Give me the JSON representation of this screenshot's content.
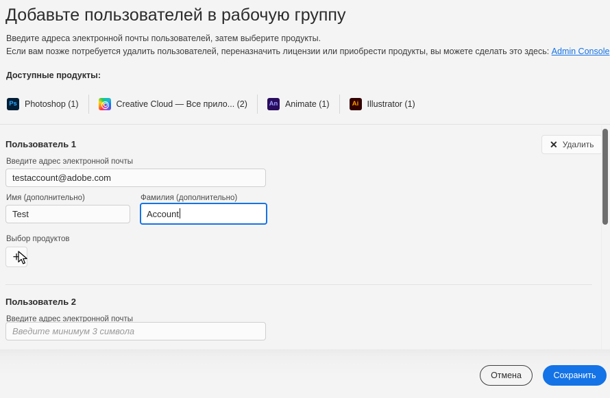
{
  "header": {
    "title": "Добавьте пользователей в рабочую группу",
    "subline1": "Введите адреса электронной почты пользователей, затем выберите продукты.",
    "subline2_before": "Если вам позже потребуется удалить пользователей, переназначить лицензии или приобрести продукты, вы можете сделать это здесь: ",
    "admin_link": "Admin Console",
    "subline2_after": "."
  },
  "products": {
    "label": "Доступные продукты:",
    "items": [
      {
        "icon": "photoshop-icon",
        "badge": "Ps",
        "name": "Photoshop (1)"
      },
      {
        "icon": "creative-cloud-icon",
        "badge": "",
        "name": "Creative Cloud — Все прило... (2)"
      },
      {
        "icon": "animate-icon",
        "badge": "An",
        "name": "Animate (1)"
      },
      {
        "icon": "illustrator-icon",
        "badge": "Ai",
        "name": "Illustrator (1)"
      }
    ]
  },
  "users": [
    {
      "title": "Пользователь 1",
      "delete_label": "Удалить",
      "email_label": "Введите адрес электронной почты",
      "email_value": "testaccount@adobe.com",
      "email_placeholder": "Введите минимум 3 символа",
      "firstname_label": "Имя (дополнительно)",
      "firstname_value": "Test",
      "lastname_label": "Фамилия (дополнительно)",
      "lastname_value": "Account",
      "products_label": "Выбор продуктов",
      "add_product_label": "+"
    },
    {
      "title": "Пользователь 2",
      "email_label": "Введите адрес электронной почты",
      "email_value": "",
      "email_placeholder": "Введите минимум 3 символа"
    }
  ],
  "footer": {
    "cancel_label": "Отмена",
    "save_label": "Сохранить"
  },
  "colors": {
    "accent_blue": "#1473e6",
    "page_bg": "#f4f4f4",
    "text": "#2c2c2c",
    "divider": "#e2e2e2",
    "scrollbar_thumb": "#6e6e6e"
  }
}
